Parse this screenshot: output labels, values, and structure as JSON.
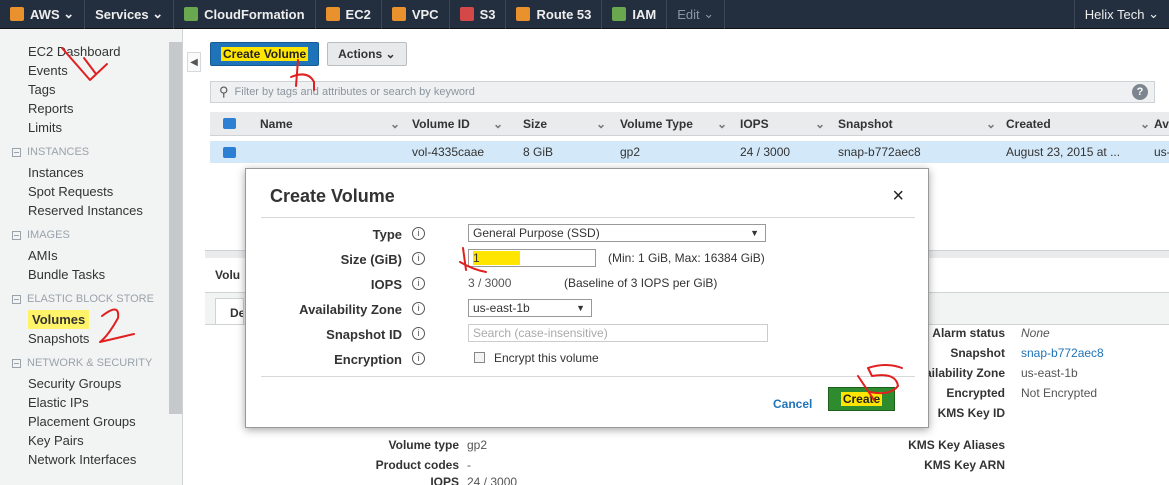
{
  "topnav": {
    "aws_label": "AWS",
    "services": "Services",
    "cloudformation": "CloudFormation",
    "ec2": "EC2",
    "vpc": "VPC",
    "s3": "S3",
    "route53": "Route 53",
    "iam": "IAM",
    "edit": "Edit",
    "user": "Helix Tech",
    "colors": {
      "bg": "#232f3e",
      "icon_orange": "#e8912d",
      "icon_green": "#6aa84f",
      "icon_red": "#d44848"
    }
  },
  "sidebar": {
    "top_links": [
      "EC2 Dashboard",
      "Events",
      "Tags",
      "Reports",
      "Limits"
    ],
    "instances_heading": "INSTANCES",
    "instances": [
      "Instances",
      "Spot Requests",
      "Reserved Instances"
    ],
    "images_heading": "IMAGES",
    "images": [
      "AMIs",
      "Bundle Tasks"
    ],
    "ebs_heading": "ELASTIC BLOCK STORE",
    "ebs_active": "Volumes",
    "ebs_other": "Snapshots",
    "network_heading": "NETWORK & SECURITY",
    "network": [
      "Security Groups",
      "Elastic IPs",
      "Placement Groups",
      "Key Pairs",
      "Network Interfaces"
    ]
  },
  "toolbar": {
    "create_volume": "Create Volume",
    "actions": "Actions"
  },
  "filter": {
    "placeholder": "Filter by tags and attributes or search by keyword"
  },
  "table": {
    "columns": [
      "Name",
      "Volume ID",
      "Size",
      "Volume Type",
      "IOPS",
      "Snapshot",
      "Created",
      "Av"
    ],
    "row": {
      "name": "",
      "volume_id": "vol-4335caae",
      "size": "8 GiB",
      "volume_type": "gp2",
      "iops": "24 / 3000",
      "snapshot": "snap-b772aec8",
      "created": "August 23, 2015 at ...",
      "az": "us-"
    }
  },
  "details": {
    "header_partial": "Volu",
    "tab_partial": "De",
    "right_labels": [
      "Alarm status",
      "Snapshot",
      "Availability Zone",
      "Encrypted",
      "KMS Key ID",
      "KMS Key Aliases",
      "KMS Key ARN"
    ],
    "right_values": [
      "None",
      "snap-b772aec8",
      "us-east-1b",
      "Not Encrypted"
    ],
    "left_labels": [
      "Volume type",
      "Product codes",
      "IOPS"
    ],
    "left_values": [
      "gp2",
      "-",
      "24 / 3000"
    ]
  },
  "modal": {
    "title": "Create Volume",
    "close": "×",
    "type_label": "Type",
    "type_value": "General Purpose (SSD)",
    "size_label": "Size (GiB)",
    "size_value": "1",
    "size_hint": "(Min: 1 GiB, Max: 16384 GiB)",
    "iops_label": "IOPS",
    "iops_value": "3 / 3000",
    "iops_hint": "(Baseline of 3 IOPS per GiB)",
    "az_label": "Availability Zone",
    "az_value": "us-east-1b",
    "snapshot_label": "Snapshot ID",
    "snapshot_placeholder": "Search (case-insensitive)",
    "encryption_label": "Encryption",
    "encryption_text": "Encrypt this volume",
    "cancel": "Cancel",
    "create": "Create",
    "info_glyph": "i"
  },
  "annotation_color": "#e02020",
  "highlight_color": "#ffe500"
}
